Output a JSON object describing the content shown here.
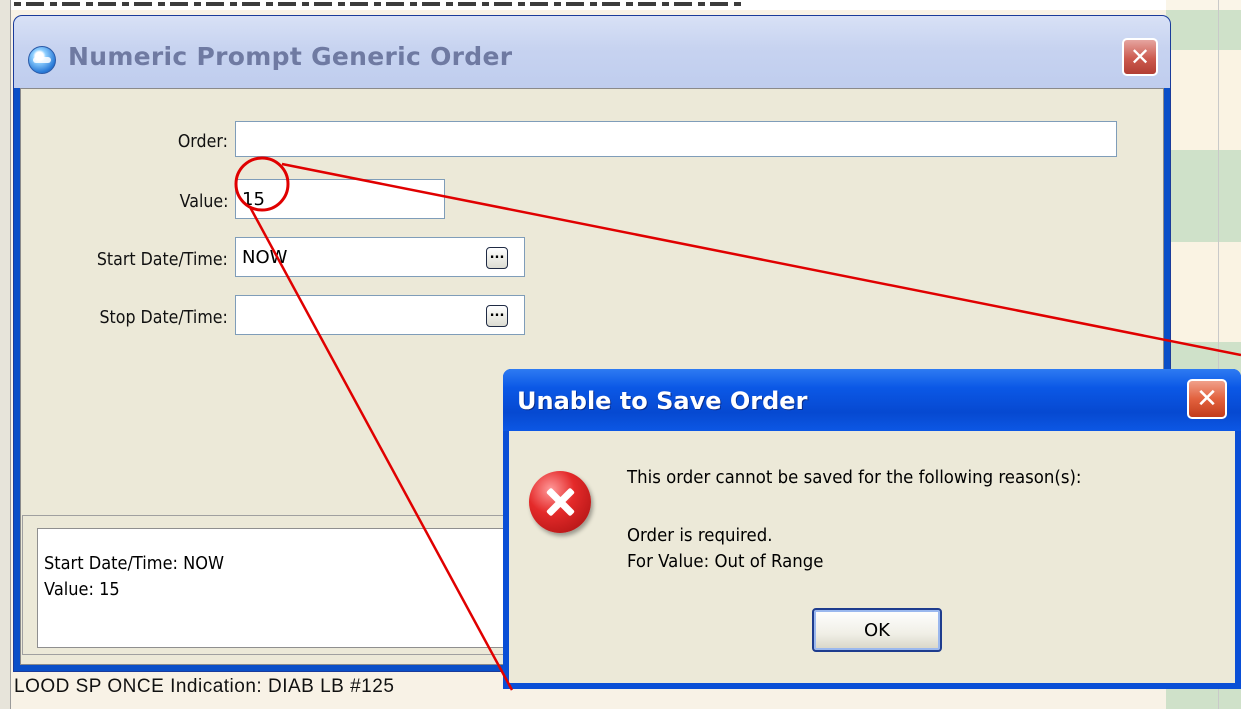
{
  "background": {
    "bottom_text": "LOOD   SP ONCE Indication: DIAB LB #125"
  },
  "main_dialog": {
    "title": "Numeric Prompt Generic Order",
    "close_glyph": "✕",
    "fields": {
      "order_label": "Order:",
      "order_value": "",
      "value_label": "Value:",
      "value_value": "15",
      "start_label": "Start Date/Time:",
      "start_value": "NOW",
      "stop_label": "Stop Date/Time:",
      "stop_value": ""
    },
    "ellipsis_glyph": "...",
    "summary": {
      "line1": "Start Date/Time:  NOW",
      "line2": "Value:  15"
    }
  },
  "error_dialog": {
    "title": "Unable to Save Order",
    "close_glyph": "✕",
    "icon": "error-icon",
    "message_heading": "This order cannot be saved for the following reason(s):",
    "reasons": [
      "Order is required.",
      "For Value:  Out of Range"
    ],
    "ok_label": "OK"
  },
  "colors": {
    "annotation": "#e00000",
    "titlebar_active": "#0a4fd6",
    "dialog_face": "#ece9d8"
  }
}
